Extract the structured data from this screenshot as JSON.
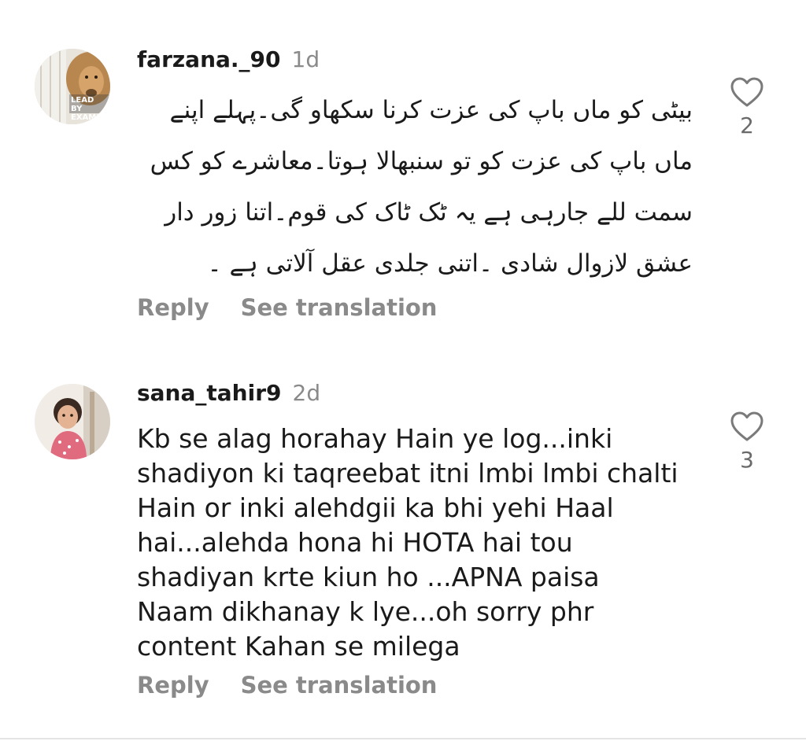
{
  "comments": [
    {
      "username": "farzana._90",
      "time": "1d",
      "avatar_icon": "lion-avatar",
      "avatar_text": "LEAD BY EXAMPL",
      "lines": [
        "بیٹی کو ماں باپ کی عزت کرنا سکھاو گی۔پہلے اپنے",
        "ماں باپ کی عزت کو تو سنبھالا ہوتا۔معاشرے کو کس",
        "سمت للے جارہی ہے یہ ٹک ٹاک کی قوم۔اتنا زور دار",
        "عشق لازوال شادی ۔اتنی جلدی عقل آلاتی ہے ۔"
      ],
      "reply_label": "Reply",
      "translate_label": "See translation",
      "likes": "2"
    },
    {
      "username": "sana_tahir9",
      "time": "2d",
      "avatar_icon": "child-photo-avatar",
      "lines": [
        "Kb se alag horahay Hain ye log...inki",
        "shadiyon ki taqreebat itni lmbi lmbi chalti",
        "Hain or inki alehdgii ka bhi yehi Haal",
        "hai...alehda hona hi HOTA hai tou",
        "shadiyan krte kiun ho ...APNA paisa",
        "Naam dikhanay k lye...oh sorry phr",
        "content Kahan se milega"
      ],
      "reply_label": "Reply",
      "translate_label": "See translation",
      "likes": "3"
    }
  ],
  "colors": {
    "text": "#1a1a1a",
    "muted": "#8a8a8a",
    "heart": "#7a7a7a",
    "background": "#ffffff"
  }
}
